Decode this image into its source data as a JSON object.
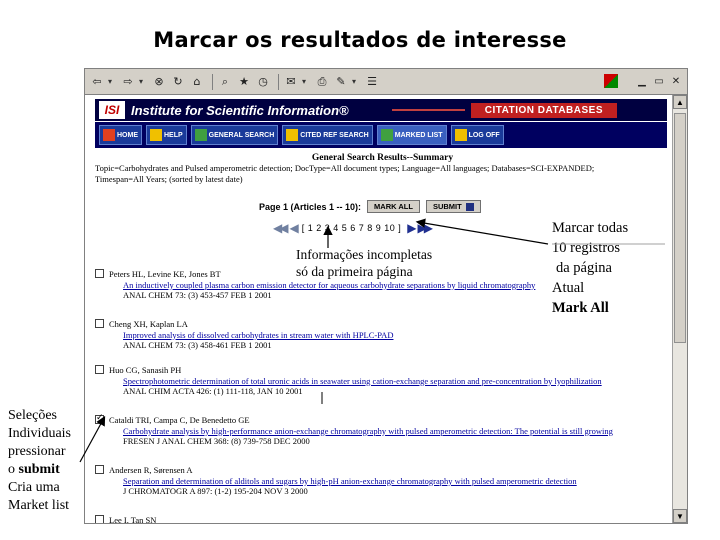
{
  "slide": {
    "title": "Marcar os resultados de interesse"
  },
  "toolbar": {
    "icons": [
      "back-icon",
      "forward-icon",
      "stop-icon",
      "refresh-icon",
      "home-icon",
      "search-icon",
      "favorites-icon",
      "history-icon",
      "mail-icon",
      "print-icon",
      "edit-icon",
      "discuss-icon"
    ]
  },
  "isi": {
    "logo": "ISI",
    "name": "Institute for Scientific Information®",
    "db_label": "CITATION DATABASES"
  },
  "nav": {
    "home": "HOME",
    "help": "HELP",
    "general_search": "GENERAL SEARCH",
    "cited_ref_search": "CITED REF SEARCH",
    "marked_list": "MARKED LIST",
    "logoff": "LOG OFF"
  },
  "results": {
    "title": "General Search Results--Summary",
    "query_line1": "Topic=Carbohydrates and Pulsed amperometric detection; DocType=All document types; Language=All languages; Databases=SCI-EXPANDED;",
    "query_line2": "Timespan=All Years; (sorted by latest date)",
    "page_label": "Page 1 (Articles 1 -- 10):",
    "mark_all": "MARK ALL",
    "submit": "SUBMIT",
    "pages": "[ 1 2 3 4 5 6 7 8 9 10 ]"
  },
  "records": [
    {
      "authors": "Peters HL, Levine KE, Jones BT",
      "title": "An inductively coupled plasma carbon emission detector for aqueous carbohydrate separations by liquid chromatography",
      "source": "ANAL CHEM 73: (3) 453-457 FEB 1 2001",
      "checked": false
    },
    {
      "authors": "Cheng XH, Kaplan LA",
      "title": "Improved analysis of dissolved carbohydrates in stream water with HPLC-PAD",
      "source": "ANAL CHEM 73: (3) 458-461 FEB 1 2001",
      "checked": false
    },
    {
      "authors": "Huo CG, Sanasih PH",
      "title": "Spectrophotometric determination of total uronic acids in seawater using cation-exchange separation and pre-concentration by lyophilization",
      "source": "ANAL CHIM ACTA 426: (1) 111-118, JAN 10 2001",
      "checked": false
    },
    {
      "authors": "Cataldi TRI, Campa C, De Benedetto GE",
      "title": "Carbohydrate analysis by high-performance anion-exchange chromatography with pulsed amperometric detection: The potential is still growing",
      "source": "FRESEN J ANAL CHEM 368: (8) 739-758 DEC 2000",
      "checked": true
    },
    {
      "authors": "Andersen R, Sørensen A",
      "title": "Separation and determination of alditols and sugars by high-pH anion-exchange chromatography with pulsed amperometric detection",
      "source": "J CHROMATOGR A 897: (1-2) 195-204 NOV 3 2000",
      "checked": false
    },
    {
      "authors": "Lee I, Tan SN",
      "title": "",
      "source": "",
      "checked": false
    }
  ],
  "annotations": {
    "left": [
      "Seleções",
      "Individuais",
      "pressionar",
      "o submit",
      "Cria uma",
      "Market list"
    ],
    "mid": [
      "Informações incompletas",
      "só da primeira página"
    ],
    "right": [
      "Marcar todas",
      "10 registros",
      "da página",
      "Atual",
      "Mark All"
    ]
  }
}
